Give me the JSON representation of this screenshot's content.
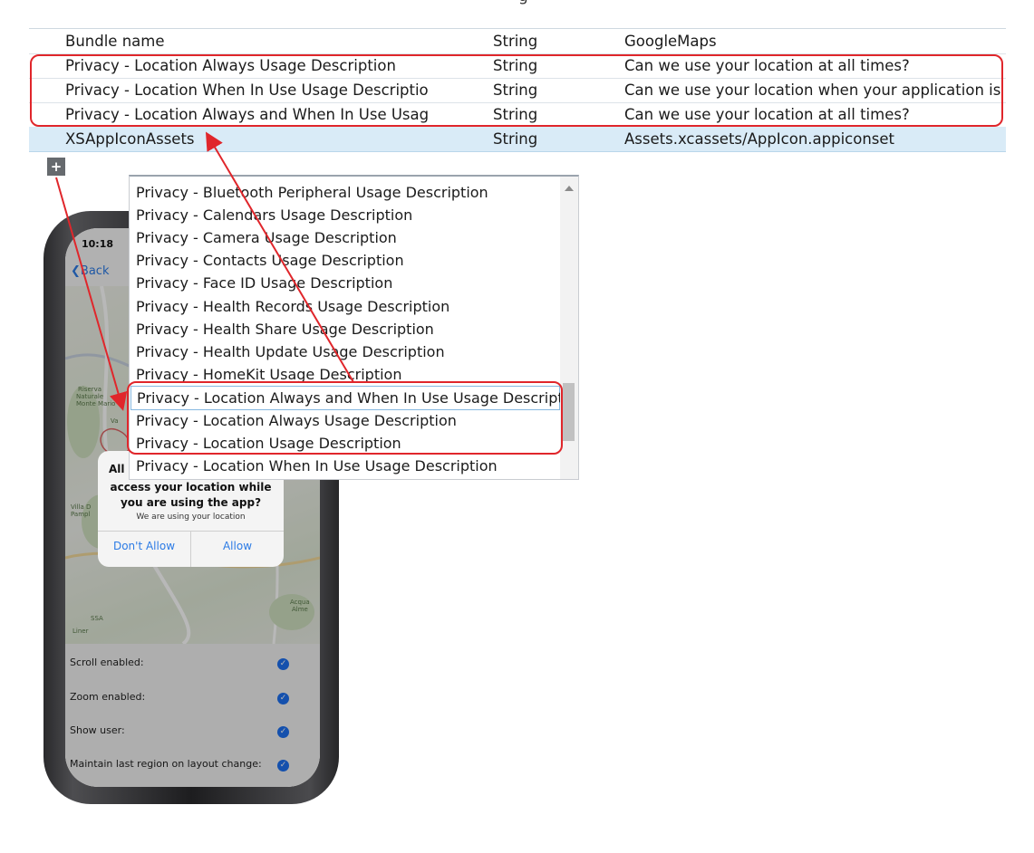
{
  "plist": {
    "partial_header": "g",
    "rows": [
      {
        "key": "Bundle name",
        "type": "String",
        "value": "GoogleMaps"
      },
      {
        "key": "Privacy - Location Always Usage Description",
        "type": "String",
        "value": "Can we use your location at all times?"
      },
      {
        "key": "Privacy - Location When In Use Usage Descriptio",
        "type": "String",
        "value": "Can we use your location when your application is b"
      },
      {
        "key": "Privacy - Location Always and When In Use Usag",
        "type": "String",
        "value": "Can we use your location at all times?"
      },
      {
        "key": "XSAppIconAssets",
        "type": "String",
        "value": "Assets.xcassets/AppIcon.appiconset"
      }
    ],
    "add_button": "+"
  },
  "dropdown": {
    "items": [
      "Privacy - Bluetooth Peripheral Usage Description",
      "Privacy - Calendars Usage Description",
      "Privacy - Camera Usage Description",
      "Privacy - Contacts Usage Description",
      "Privacy - Face ID Usage Description",
      "Privacy - Health Records Usage Description",
      "Privacy - Health Share Usage Description",
      "Privacy - Health Update Usage Description",
      "Privacy - HomeKit Usage Description",
      "Privacy - Location Always and When In Use Usage Description",
      "Privacy - Location Always Usage Description",
      "Privacy - Location Usage Description",
      "Privacy - Location When In Use Usage Description"
    ]
  },
  "phone": {
    "time": "10:18",
    "back_label": "Back",
    "map_labels": [
      "Riserva",
      "Naturale",
      "Monte Mario",
      "Villa D",
      "Pampl",
      "Acqua",
      "Alme",
      "Liner",
      "SSA",
      "Va"
    ],
    "dialog": {
      "title_visible": "All",
      "title_line2": "access your location while",
      "title_line3": "you are using the app?",
      "message": "We are using your location",
      "dont_allow": "Don't Allow",
      "allow": "Allow"
    },
    "settings": [
      {
        "label": "Scroll enabled:",
        "checked": true
      },
      {
        "label": "Zoom enabled:",
        "checked": true
      },
      {
        "label": "Show user:",
        "checked": true
      },
      {
        "label": "Maintain last region on layout change:",
        "checked": true
      }
    ],
    "check_glyph": "✓"
  },
  "colors": {
    "highlight_box": "#e0262b",
    "selected_row": "#d9ebf7",
    "ios_blue": "#2c7be5"
  }
}
